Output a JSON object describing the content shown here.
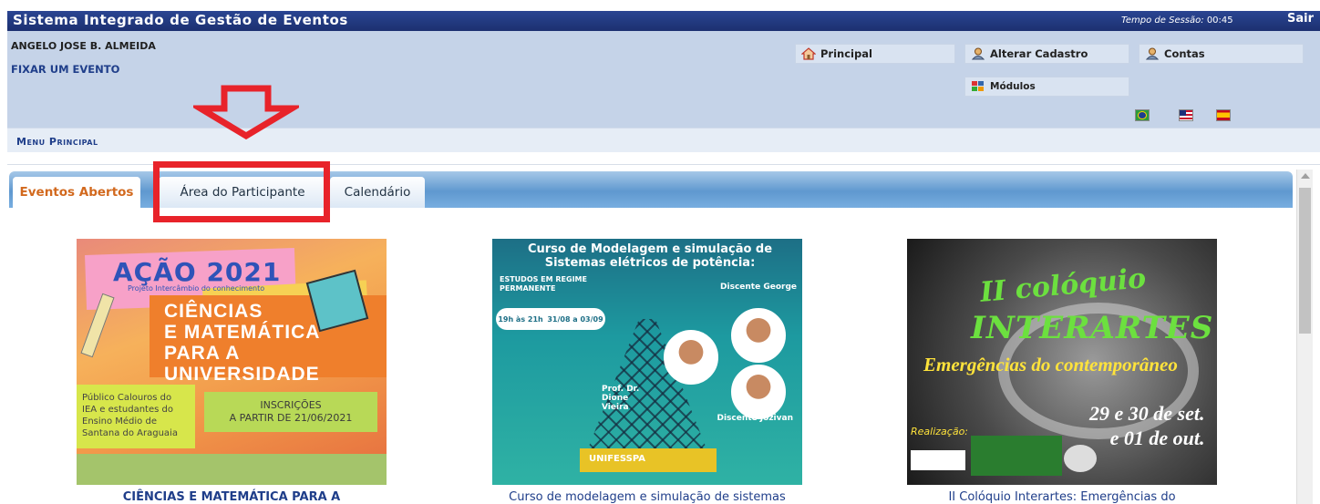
{
  "header": {
    "app_title": "Sistema Integrado de Gestão de Eventos",
    "session_label": "Tempo de Sessão:",
    "session_time": "00:45",
    "logout_label": "Sair"
  },
  "user": {
    "name": "ANGELO JOSE B. ALMEIDA",
    "fix_event_link": "FIXAR UM EVENTO"
  },
  "top_nav": {
    "principal": "Principal",
    "alterar_cadastro": "Alterar Cadastro",
    "contas": "Contas",
    "modulos": "Módulos"
  },
  "menu": {
    "title": "Menu Principal"
  },
  "tabs": [
    {
      "label": "Eventos Abertos",
      "active": true
    },
    {
      "label": "Área do Participante",
      "active": false
    },
    {
      "label": "Calendário",
      "active": false
    }
  ],
  "events": [
    {
      "caption": "CIÊNCIAS E MATEMÁTICA PARA A",
      "poster": {
        "title": "AÇÃO 2021",
        "subtitle": "Projeto Intercâmbio do conhecimento",
        "headline": [
          "CIÊNCIAS",
          "E MATEMÁTICA",
          "PARA A UNIVERSIDADE"
        ],
        "audience": [
          "Público Calouros do",
          "IEA e estudantes do",
          "Ensino Médio de",
          "Santana do Araguaia"
        ],
        "registration": [
          "INSCRIÇÕES",
          "A PARTIR DE 21/06/2021"
        ]
      }
    },
    {
      "caption": "Curso de modelagem e simulação de sistemas",
      "poster": {
        "title": [
          "Curso de Modelagem e simulação de",
          "Sistemas elétricos de potência:"
        ],
        "subtitle": [
          "ESTUDOS EM REGIME",
          "PERMANENTE"
        ],
        "time": "19h às 21h",
        "dates": "31/08 a 03/09",
        "people": [
          "Discente George",
          "Prof. Dr. Dione Vieira",
          "Discente Jozivan"
        ],
        "logo": "UNIFESSPA"
      }
    },
    {
      "caption": "II Colóquio Interartes: Emergências do",
      "poster": {
        "title": [
          "II colóquio",
          "INTERARTES"
        ],
        "subtitle": "Emergências do contemporâneo",
        "dates": [
          "29 e 30 de set.",
          "e 01 de out."
        ],
        "footer": "Realização:"
      }
    }
  ],
  "colors": {
    "header_bg": "#1c3070",
    "panel_bg": "#c5d3e8",
    "active_tab_text": "#d2691e",
    "link_blue": "#1f3e8a",
    "annotation_red": "#e8232a"
  }
}
